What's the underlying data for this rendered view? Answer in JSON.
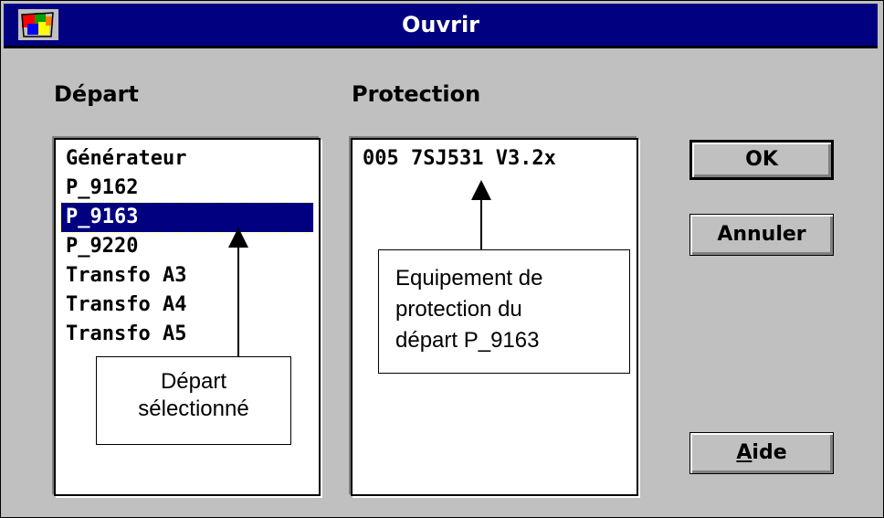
{
  "window": {
    "title": "Ouvrir"
  },
  "labels": {
    "depart": "Départ",
    "protection": "Protection"
  },
  "depart_list": {
    "items": [
      "Générateur",
      "P_9162",
      "P_9163",
      "P_9220",
      "Transfo A3",
      "Transfo A4",
      "Transfo A5"
    ],
    "selected_index": 2
  },
  "protection_list": {
    "items": [
      "005 7SJ531 V3.2x"
    ]
  },
  "buttons": {
    "ok": "OK",
    "annuler": "Annuler",
    "aide_mnemonic": "A",
    "aide_rest": "ide"
  },
  "callouts": {
    "depart": {
      "line1": "Départ",
      "line2": "sélectionné"
    },
    "protection": {
      "line1": "Equipement de",
      "line2": "protection du",
      "line3": "départ P_9163"
    }
  },
  "colors": {
    "titlebar": "#000080",
    "dialog_bg": "#c0c0c0",
    "selection": "#000080"
  }
}
